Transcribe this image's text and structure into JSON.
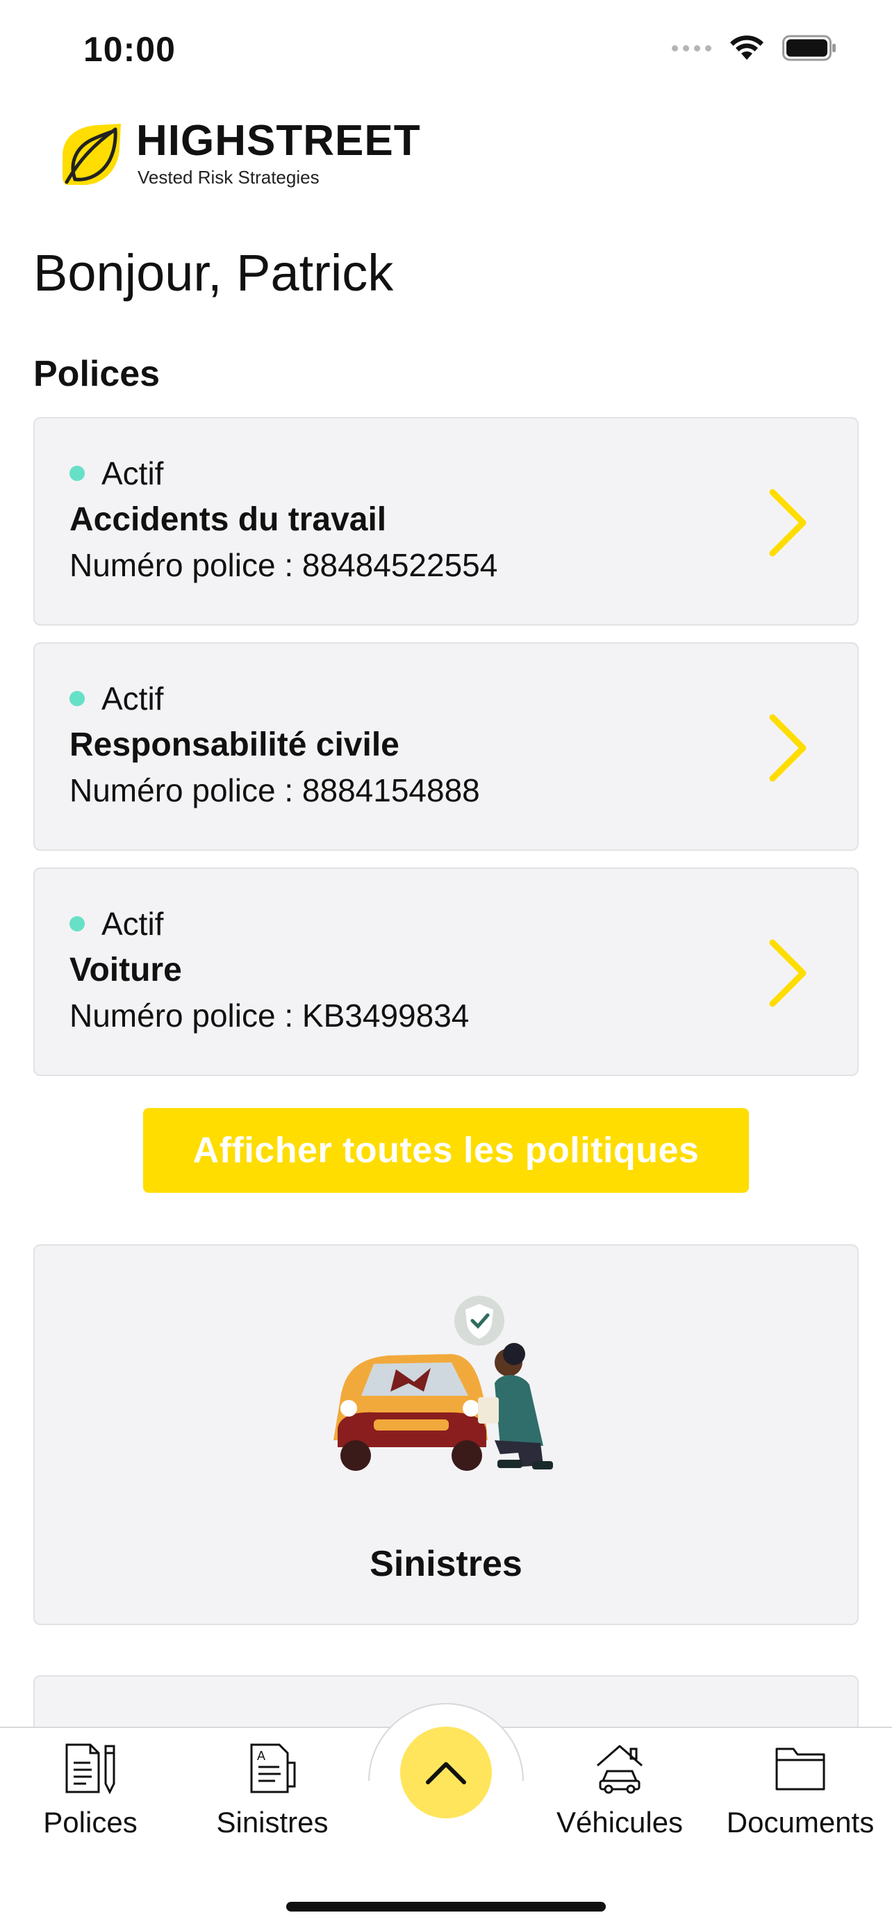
{
  "status_bar": {
    "time": "10:00",
    "icons": [
      "cellular-signal-icon",
      "wifi-icon",
      "battery-icon"
    ]
  },
  "brand": {
    "name": "HIGHSTREET",
    "tagline": "Vested Risk Strategies",
    "accent_color": "#ffdd00"
  },
  "greeting": "Bonjour, Patrick",
  "policies": {
    "title": "Polices",
    "items": [
      {
        "status": "Actif",
        "name": "Accidents du travail",
        "number": "Numéro police : 88484522554"
      },
      {
        "status": "Actif",
        "name": "Responsabilité civile",
        "number": "Numéro police : 8884154888"
      },
      {
        "status": "Actif",
        "name": "Voiture",
        "number": "Numéro police : KB3499834"
      }
    ],
    "status_color": "#66e0c7",
    "view_all_label": "Afficher toutes les politiques"
  },
  "claims_card": {
    "label": "Sinistres",
    "illustration": "car-damage-inspection-illustration"
  },
  "tab_bar": {
    "items": [
      {
        "label": "Polices",
        "icon": "policy-document-icon"
      },
      {
        "label": "Sinistres",
        "icon": "claim-form-icon"
      },
      {
        "label": "Véhicules",
        "icon": "car-garage-icon"
      },
      {
        "label": "Documents",
        "icon": "folder-icon"
      }
    ],
    "fab_icon": "chevron-up-icon"
  }
}
